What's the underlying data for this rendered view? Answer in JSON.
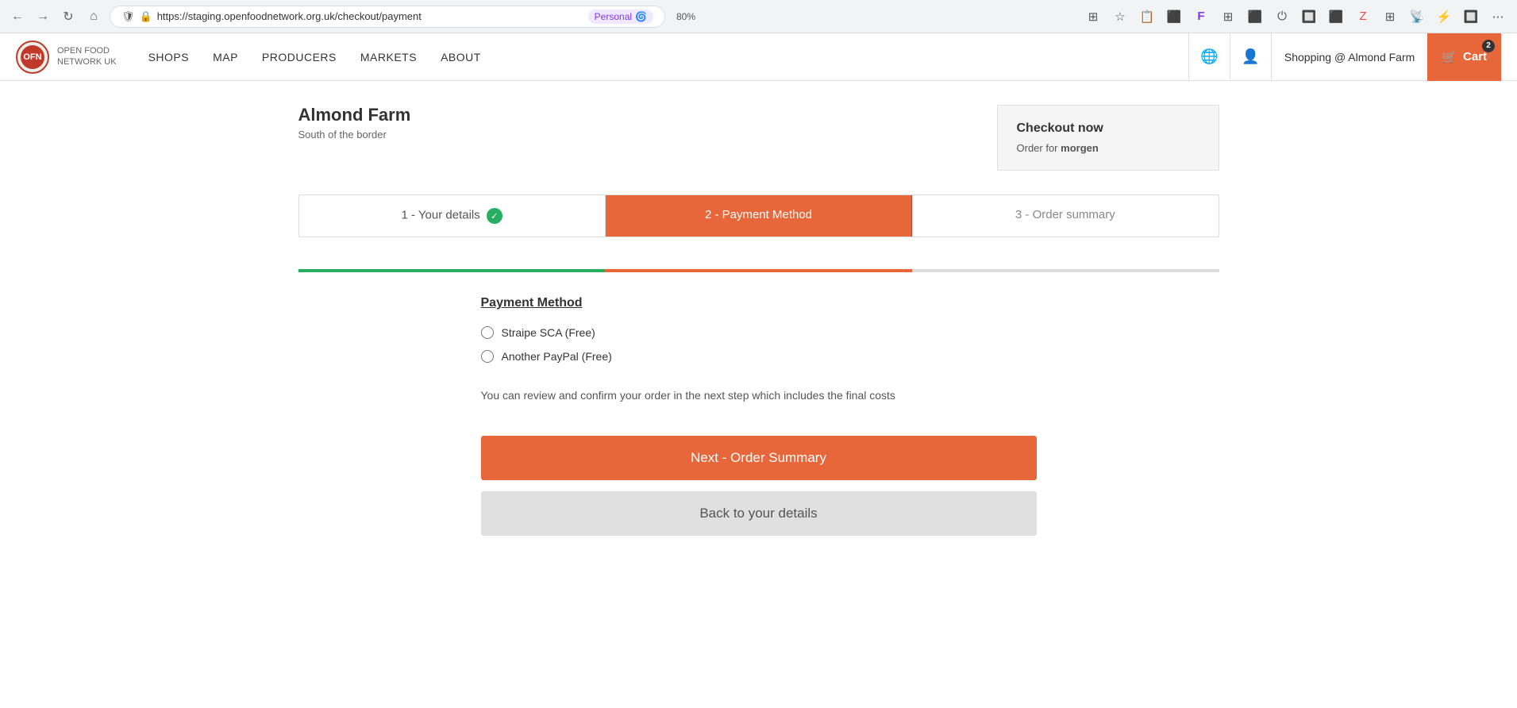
{
  "browser": {
    "back_button": "←",
    "forward_button": "→",
    "refresh_button": "↻",
    "home_button": "⌂",
    "url_prefix": "https://staging.",
    "url_highlight": "openfoodnetwork.org.uk",
    "url_suffix": "/checkout/payment",
    "personal_label": "Personal",
    "zoom_label": "80%",
    "right_icons": [
      "⊞",
      "☆",
      "📋",
      "⚡",
      "👤",
      "🔲",
      "🔑",
      "⬛",
      "🔷",
      "Z",
      "⊞",
      "📡",
      "⚡",
      "🔲"
    ]
  },
  "nav": {
    "logo_line1": "OPEN FOOD",
    "logo_line2": "NETWORK UK",
    "links": [
      "SHOPS",
      "MAP",
      "PRODUCERS",
      "MARKETS",
      "ABOUT"
    ],
    "shopping_label": "Shopping @ Almond Farm",
    "cart_label": "Cart",
    "cart_count": "2"
  },
  "shop": {
    "name": "Almond Farm",
    "subtitle": "South of the border"
  },
  "checkout_panel": {
    "title": "Checkout now",
    "order_prefix": "Order for",
    "order_user": "morgen"
  },
  "steps": [
    {
      "label": "1 - Your details",
      "status": "done"
    },
    {
      "label": "2 - Payment Method",
      "status": "active"
    },
    {
      "label": "3 - Order summary",
      "status": "inactive"
    }
  ],
  "payment": {
    "section_title": "Payment Method",
    "options": [
      {
        "id": "stripe",
        "label": "Straipe SCA (Free)"
      },
      {
        "id": "paypal",
        "label": "Another PayPal (Free)"
      }
    ],
    "review_text": "You can review and confirm your order in the next step which includes the final costs",
    "next_button": "Next - Order Summary",
    "back_button": "Back to your details"
  }
}
